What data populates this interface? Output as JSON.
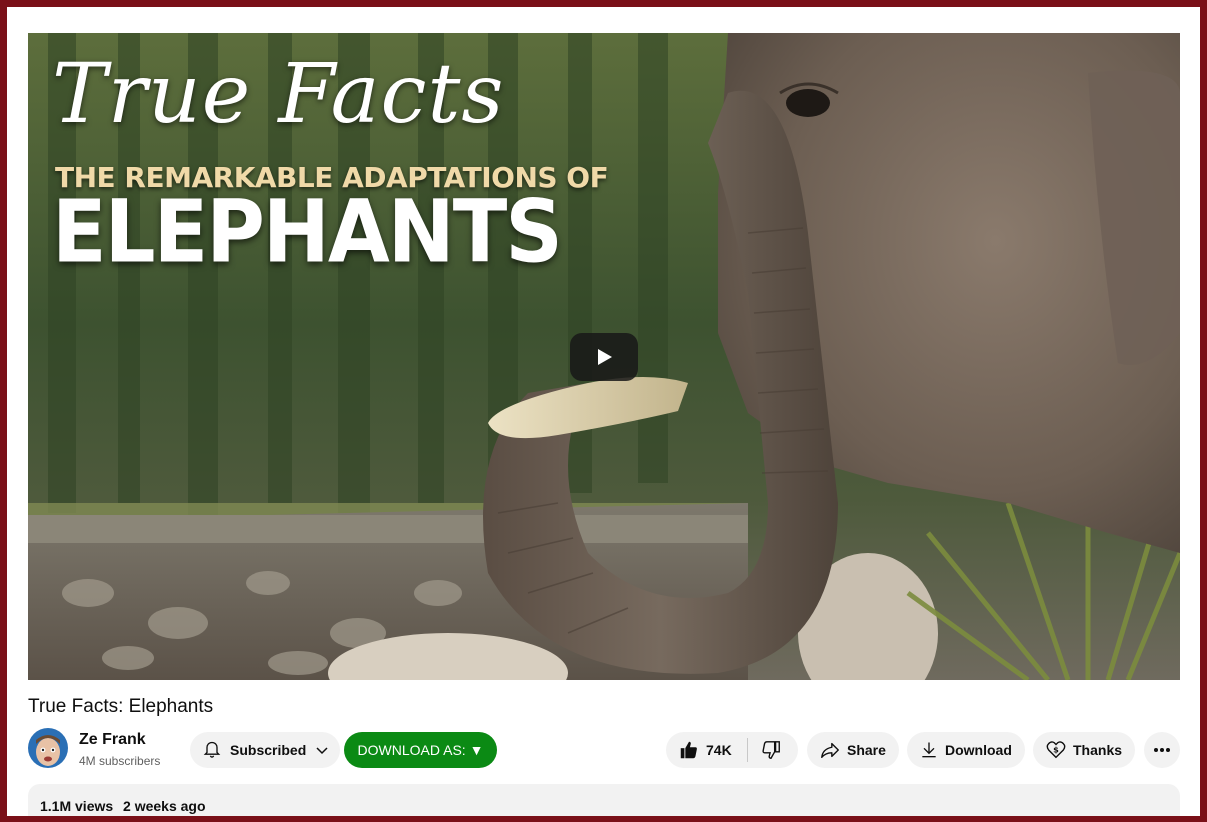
{
  "video": {
    "thumbnail": {
      "script_title": "True Facts",
      "subtitle": "THE REMARKABLE ADAPTATIONS OF",
      "main_title": "ELEPHANTS"
    },
    "title": "True Facts: Elephants"
  },
  "channel": {
    "name": "Ze Frank",
    "subscribers": "4M subscribers",
    "subscribe_label": "Subscribed"
  },
  "actions": {
    "download_as_label": "DOWNLOAD AS: ▼",
    "likes": "74K",
    "share_label": "Share",
    "download_label": "Download",
    "thanks_label": "Thanks"
  },
  "description": {
    "views": "1.1M views",
    "age": "2 weeks ago"
  },
  "colors": {
    "frame": "#7a1018",
    "download_as_bg": "#0b8a14",
    "pill_bg": "#f2f2f2"
  },
  "icons": [
    "play-icon",
    "bell-icon",
    "chevron-down-icon",
    "thumbs-up-icon",
    "thumbs-down-icon",
    "share-icon",
    "download-icon",
    "thanks-icon",
    "more-icon"
  ]
}
